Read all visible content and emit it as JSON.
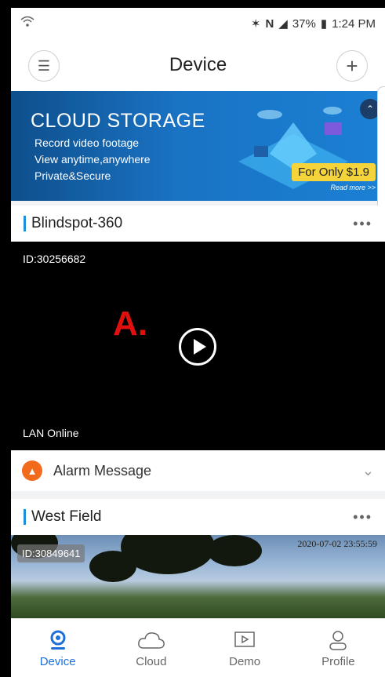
{
  "status_bar": {
    "battery": "37%",
    "time": "1:24 PM",
    "icons": [
      "wifi-icon",
      "bluetooth-icon",
      "nfc-icon",
      "wifi-icon",
      "signal-icon",
      "battery-icon"
    ]
  },
  "header": {
    "title": "Device",
    "menu_icon": "list-icon",
    "add_icon": "plus-icon"
  },
  "banner": {
    "title": "CLOUD STORAGE",
    "line1": "Record video footage",
    "line2": "View anytime,anywhere",
    "line3": "Private&Secure",
    "price": "For Only $1.9",
    "more": "Read more >>"
  },
  "devices": [
    {
      "name": "Blindspot-360",
      "id": "ID:30256682",
      "status": "LAN Online",
      "annotation": "A."
    },
    {
      "name": "West Field",
      "id": "ID:30849641",
      "timestamp": "2020-07-02 23:55:59"
    }
  ],
  "alarm": {
    "label": "Alarm Message"
  },
  "tabs": [
    {
      "label": "Device",
      "icon": "location-pin-icon",
      "active": true
    },
    {
      "label": "Cloud",
      "icon": "cloud-icon",
      "active": false
    },
    {
      "label": "Demo",
      "icon": "play-square-icon",
      "active": false
    },
    {
      "label": "Profile",
      "icon": "person-icon",
      "active": false
    }
  ],
  "colors": {
    "accent": "#1e6fd9",
    "annotation": "#e0100f",
    "alarm_icon": "#f26b1c"
  }
}
